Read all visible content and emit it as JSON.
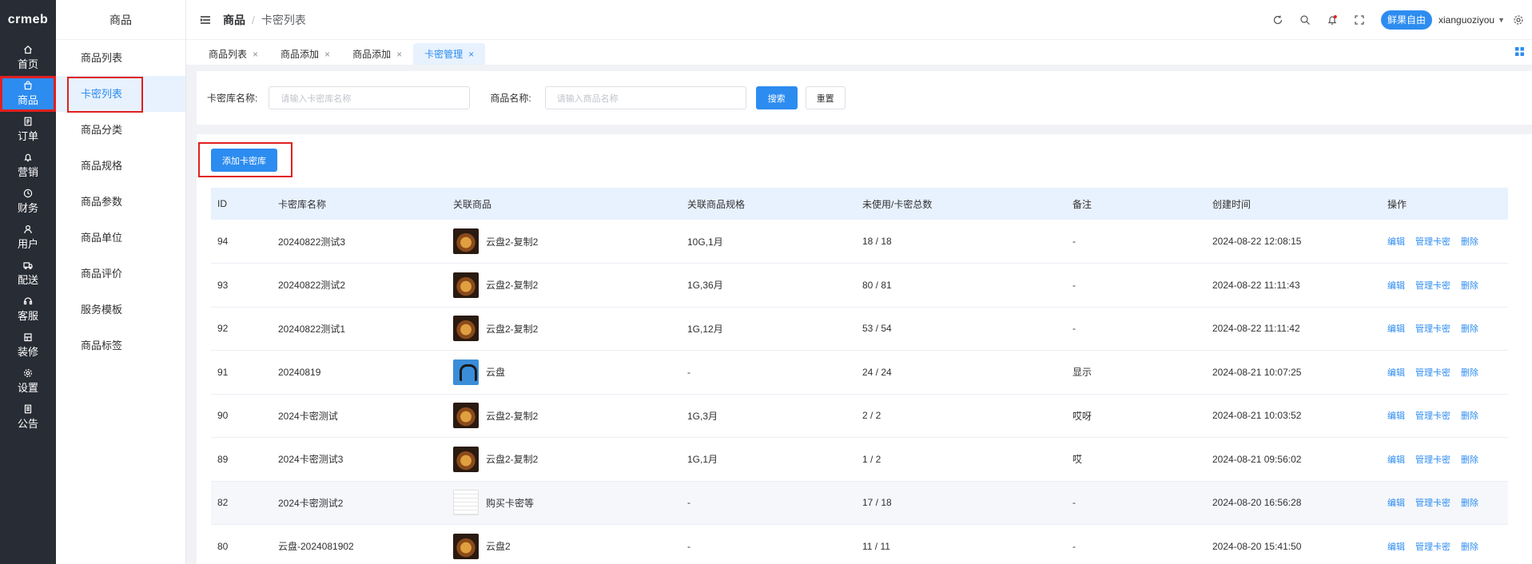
{
  "rail": {
    "logo": "crmeb",
    "items": [
      {
        "label": "首页",
        "icon": "home-icon"
      },
      {
        "label": "商品",
        "icon": "bag-icon",
        "active": true
      },
      {
        "label": "订单",
        "icon": "order-icon"
      },
      {
        "label": "营销",
        "icon": "bell-icon"
      },
      {
        "label": "财务",
        "icon": "finance-icon"
      },
      {
        "label": "用户",
        "icon": "user-icon"
      },
      {
        "label": "配送",
        "icon": "truck-icon"
      },
      {
        "label": "客服",
        "icon": "headset-icon"
      },
      {
        "label": "装修",
        "icon": "decorate-icon"
      },
      {
        "label": "设置",
        "icon": "settings-icon"
      },
      {
        "label": "公告",
        "icon": "notice-icon"
      }
    ]
  },
  "submenu": {
    "title": "商品",
    "items": [
      "商品列表",
      "卡密列表",
      "商品分类",
      "商品规格",
      "商品参数",
      "商品单位",
      "商品评价",
      "服务模板",
      "商品标签"
    ],
    "active_index": 1
  },
  "header": {
    "breadcrumb": [
      "商品",
      "卡密列表"
    ],
    "icons": [
      "refresh-icon",
      "search-icon",
      "notification-icon",
      "fullscreen-icon"
    ],
    "avatar_text": "鲜果自由",
    "username": "xianguoziyou"
  },
  "tabs": [
    {
      "label": "商品列表",
      "active": false
    },
    {
      "label": "商品添加",
      "active": false
    },
    {
      "label": "商品添加",
      "active": false
    },
    {
      "label": "卡密管理",
      "active": true
    }
  ],
  "search": {
    "lib_label": "卡密库名称:",
    "lib_placeholder": "请输入卡密库名称",
    "product_label": "商品名称:",
    "product_placeholder": "请输入商品名称",
    "search_button": "搜索",
    "reset_button": "重置"
  },
  "add_button": "添加卡密库",
  "table": {
    "columns": [
      "ID",
      "卡密库名称",
      "关联商品",
      "关联商品规格",
      "未使用/卡密总数",
      "备注",
      "创建时间",
      "操作"
    ],
    "actions": [
      "编辑",
      "管理卡密",
      "删除"
    ],
    "rows": [
      {
        "id": "94",
        "name": "20240822测试3",
        "thumb": "food",
        "product": "云盘2-复制2",
        "spec": "10G,1月",
        "count": "18 / 18",
        "remark": "-",
        "time": "2024-08-22 12:08:15"
      },
      {
        "id": "93",
        "name": "20240822测试2",
        "thumb": "food",
        "product": "云盘2-复制2",
        "spec": "1G,36月",
        "count": "80 / 81",
        "remark": "-",
        "time": "2024-08-22 11:11:43"
      },
      {
        "id": "92",
        "name": "20240822测试1",
        "thumb": "food",
        "product": "云盘2-复制2",
        "spec": "1G,12月",
        "count": "53 / 54",
        "remark": "-",
        "time": "2024-08-22 11:11:42"
      },
      {
        "id": "91",
        "name": "20240819",
        "thumb": "headset",
        "product": "云盘",
        "spec": "-",
        "count": "24 / 24",
        "remark": "显示",
        "time": "2024-08-21 10:07:25"
      },
      {
        "id": "90",
        "name": "2024卡密测试",
        "thumb": "food",
        "product": "云盘2-复制2",
        "spec": "1G,3月",
        "count": "2 / 2",
        "remark": "哎呀",
        "time": "2024-08-21 10:03:52"
      },
      {
        "id": "89",
        "name": "2024卡密测试3",
        "thumb": "food",
        "product": "云盘2-复制2",
        "spec": "1G,1月",
        "count": "1 / 2",
        "remark": "哎",
        "time": "2024-08-21 09:56:02"
      },
      {
        "id": "82",
        "name": "2024卡密测试2",
        "thumb": "doc",
        "product": "购买卡密等",
        "spec": "-",
        "count": "17 / 18",
        "remark": "-",
        "time": "2024-08-20 16:56:28"
      },
      {
        "id": "80",
        "name": "云盘-2024081902",
        "thumb": "food",
        "product": "云盘2",
        "spec": "-",
        "count": "11 / 11",
        "remark": "-",
        "time": "2024-08-20 15:41:50"
      }
    ]
  }
}
